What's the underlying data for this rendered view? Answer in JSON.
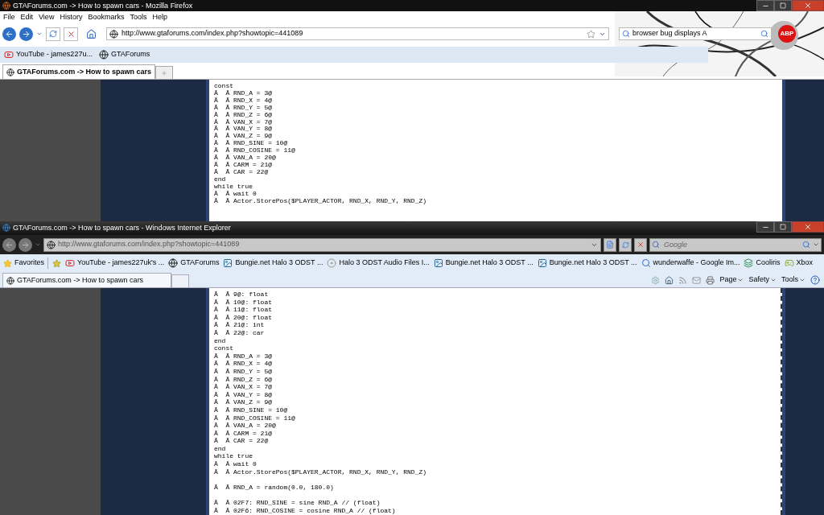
{
  "firefox": {
    "title": "GTAForums.com -> How to spawn cars - Mozilla Firefox",
    "menu": [
      "File",
      "Edit",
      "View",
      "History",
      "Bookmarks",
      "Tools",
      "Help"
    ],
    "address": "http://www.gtaforums.com/index.php?showtopic=441089",
    "search": "browser bug displays A",
    "addon": "ABP",
    "bookmarks": [
      {
        "label": "YouTube - james227u...",
        "kind": "youtube"
      },
      {
        "label": "GTAForums",
        "kind": "globe"
      }
    ],
    "tabs": [
      {
        "label": "GTAForums.com -> How to spawn cars",
        "selected": true
      }
    ],
    "code_blocks": [
      [
        "const",
        "Â  Â RND_A = 3@",
        "Â  Â RND_X = 4@",
        "Â  Â RND_Y = 5@",
        "Â  Â RND_Z = 6@",
        "Â  Â VAN_X = 7@",
        "Â  Â VAN_Y = 8@",
        "Â  Â VAN_Z = 9@",
        "Â  Â RND_SINE = 10@",
        "Â  Â RND_COSINE = 11@",
        "Â  Â VAN_A = 20@",
        "Â  Â CARM = 21@",
        "Â  Â CAR = 22@",
        "end",
        "while true",
        "Â  Â wait 0",
        "Â  Â Actor.StorePos($PLAYER_ACTOR, RND_X, RND_Y, RND_Z)"
      ]
    ]
  },
  "ie": {
    "title": "GTAForums.com -> How to spawn cars - Windows Internet Explorer",
    "address": "http://www.gtaforums.com/index.php?showtopic=441089",
    "search_placeholder": "Google",
    "favorites_label": "Favorites",
    "favorites": [
      {
        "label": "YouTube - james227uk's ...",
        "kind": "youtube"
      },
      {
        "label": "GTAForums",
        "kind": "globe"
      },
      {
        "label": "Bungie.net  Halo 3 ODST ...",
        "kind": "bungie"
      },
      {
        "label": "Halo 3 ODST Audio Files I...",
        "kind": "disc"
      },
      {
        "label": "Bungie.net  Halo 3 ODST ...",
        "kind": "bungie"
      },
      {
        "label": "Bungie.net  Halo 3 ODST ...",
        "kind": "bungie"
      },
      {
        "label": "wunderwaffe - Google Im...",
        "kind": "google"
      },
      {
        "label": "Cooliris",
        "kind": "cooliris"
      },
      {
        "label": "Xbox",
        "kind": "xbox"
      }
    ],
    "tabs": [
      {
        "label": "GTAForums.com -> How to spawn cars",
        "selected": true
      }
    ],
    "commands": [
      "Page",
      "Safety",
      "Tools"
    ],
    "code_blocks": [
      [
        "Â  Â 9@: float",
        "Â  Â 10@: float",
        "Â  Â 11@: float",
        "Â  Â 20@: float",
        "Â  Â 21@: int",
        "Â  Â 22@: car",
        "end",
        "const",
        "Â  Â RND_A = 3@",
        "Â  Â RND_X = 4@",
        "Â  Â RND_Y = 5@",
        "Â  Â RND_Z = 6@",
        "Â  Â VAN_X = 7@",
        "Â  Â VAN_Y = 8@",
        "Â  Â VAN_Z = 9@",
        "Â  Â RND_SINE = 10@",
        "Â  Â RND_COSINE = 11@",
        "Â  Â VAN_A = 20@",
        "Â  Â CARM = 21@",
        "Â  Â CAR = 22@",
        "end",
        "while true",
        "Â  Â wait 0",
        "Â  Â Actor.StorePos($PLAYER_ACTOR, RND_X, RND_Y, RND_Z)"
      ],
      [
        "Â  Â RND_A = random(0.0, 180.0)"
      ],
      [
        "Â  Â 02F7: RND_SINE = sine RND_A // (float)",
        "Â  Â 02F6: RND_COSINE = cosine RND_A // (float)"
      ]
    ]
  }
}
